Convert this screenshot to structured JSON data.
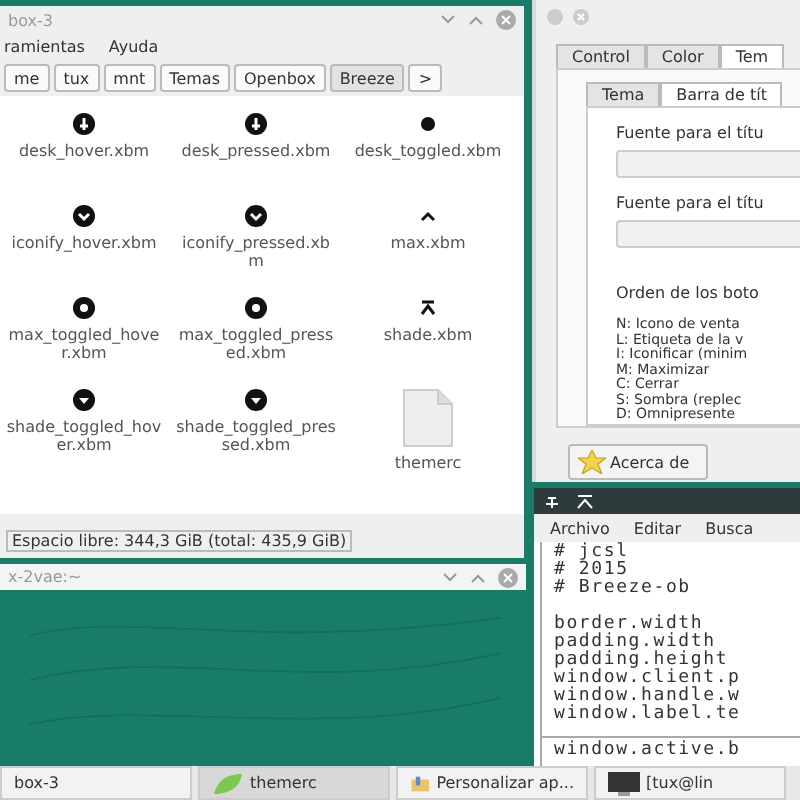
{
  "file_manager": {
    "title": "box-3",
    "menu": [
      "ramientas",
      "Ayuda"
    ],
    "path": [
      {
        "label": "me",
        "selected": false
      },
      {
        "label": "tux",
        "selected": false
      },
      {
        "label": "mnt",
        "selected": false
      },
      {
        "label": "Temas",
        "selected": false
      },
      {
        "label": "Openbox",
        "selected": false
      },
      {
        "label": "Breeze",
        "selected": true
      },
      {
        "label": ">",
        "selected": false
      }
    ],
    "files": [
      {
        "name": "desk_hover.xbm",
        "kind": "pin"
      },
      {
        "name": "desk_pressed.xbm",
        "kind": "pin"
      },
      {
        "name": "desk_toggled.xbm",
        "kind": "dot"
      },
      {
        "name": "iconify_hover.xbm",
        "kind": "down"
      },
      {
        "name": "iconify_pressed.xbm",
        "kind": "down"
      },
      {
        "name": "max.xbm",
        "kind": "caret"
      },
      {
        "name": "max_toggled_hover.xbm",
        "kind": "ring"
      },
      {
        "name": "max_toggled_pressed.xbm",
        "kind": "ring"
      },
      {
        "name": "shade.xbm",
        "kind": "shade"
      },
      {
        "name": "shade_toggled_hover.xbm",
        "kind": "tri"
      },
      {
        "name": "shade_toggled_pressed.xbm",
        "kind": "tri"
      },
      {
        "name": "themerc",
        "kind": "doc"
      }
    ],
    "status": "Espacio libre: 344,3 GiB (total: 435,9 GiB)"
  },
  "collapsed_window": {
    "title": "x-2vae:~"
  },
  "settings": {
    "tabs": [
      {
        "label": "Control",
        "selected": false
      },
      {
        "label": "Color",
        "selected": false
      },
      {
        "label": "Tem",
        "selected": true
      }
    ],
    "subtabs": [
      {
        "label": "Tema",
        "selected": false
      },
      {
        "label": "Barra de tít",
        "selected": true
      }
    ],
    "font_labels": [
      "Fuente para el títu",
      "Fuente para el títu"
    ],
    "order_label": "Orden de los boto",
    "legend": [
      "N: Icono de venta",
      "L: Etiqueta de la v",
      "I: Iconificar (minim",
      "M: Maximizar",
      "C: Cerrar",
      "S: Sombra (replec",
      "D: Omnipresente"
    ],
    "about_button": "Acerca de"
  },
  "editor": {
    "menu": [
      "Archivo",
      "Editar",
      "Busca"
    ],
    "header": [
      "# jcsl",
      "# 2015",
      "# Breeze-ob"
    ],
    "body": [
      "border.width",
      "padding.width",
      "padding.height",
      "window.client.p",
      "window.handle.w",
      "window.label.te"
    ],
    "tail": "window.active.b"
  },
  "taskbar": [
    {
      "label": "box-3",
      "kind": "plain",
      "selected": false
    },
    {
      "label": "themerc",
      "kind": "editor",
      "selected": true
    },
    {
      "label": "Personalizar ap...",
      "kind": "settings",
      "selected": false
    },
    {
      "label": "[tux@lin",
      "kind": "terminal",
      "selected": false
    }
  ]
}
